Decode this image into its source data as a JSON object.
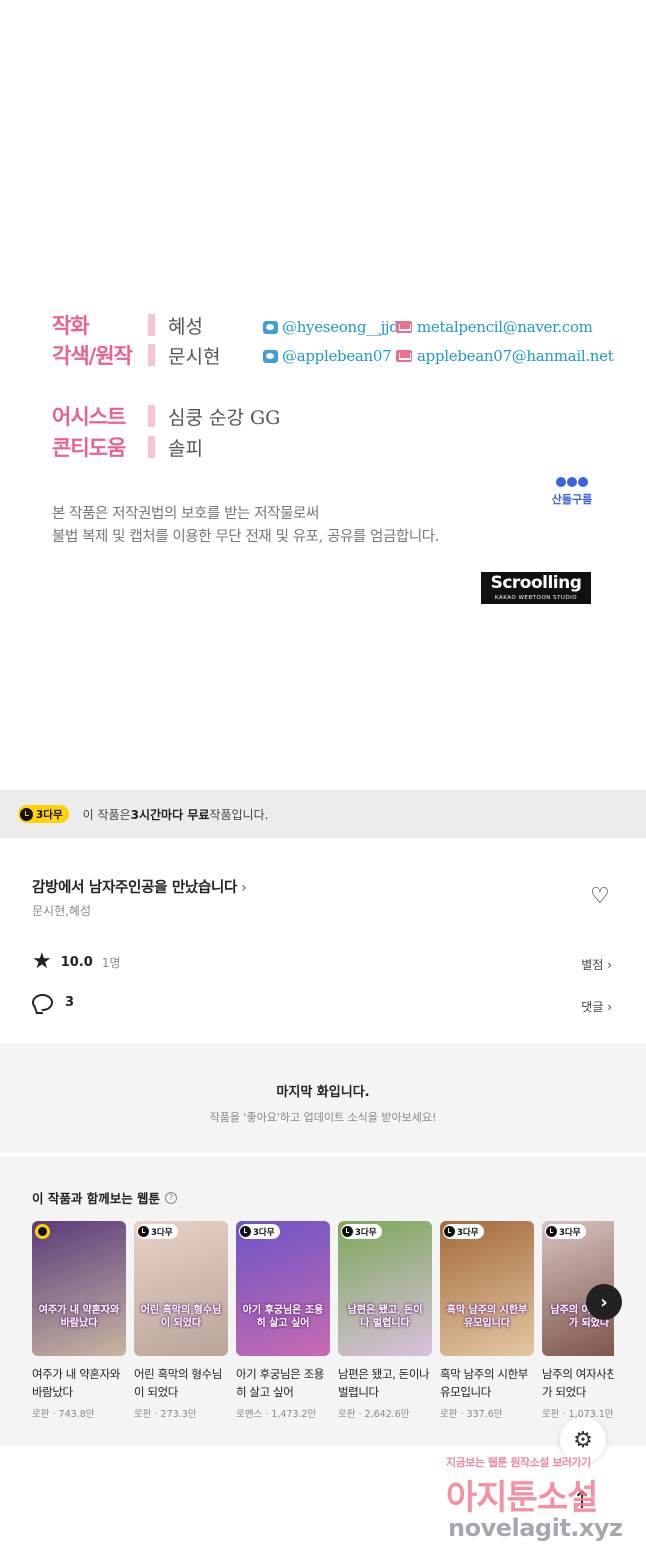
{
  "credits": {
    "rows": [
      {
        "role": "작화",
        "name": "혜성"
      },
      {
        "role": "각색/원작",
        "name": "문시현"
      },
      {
        "role": "어시스트",
        "name": "심쿵 순강 GG"
      },
      {
        "role": "콘티도움",
        "name": "솔피"
      }
    ],
    "social": {
      "twitter_1": "@hyeseong__jjd",
      "mail_1": "metalpencil@naver.com",
      "twitter_2": "@applebean07",
      "mail_2": "applebean07@hanmail.net"
    },
    "studio_label": "산돌구름",
    "notice_line1": "본 작품은 저작권법의 보호를 받는 저작물로써",
    "notice_line2": "불법 복제 및 캡처를 이용한 무단 전재 및 유포, 공유를 엄금합니다.",
    "logo_big": "Scroolling",
    "logo_small": "KAKAO WEBTOON STUDIO"
  },
  "free_banner": {
    "badge": "3다무",
    "text_pre": "이 작품은 ",
    "text_bold": "3시간마다 무료",
    "text_post": " 작품입니다."
  },
  "series": {
    "title": "감방에서 남자주인공을 만났습니다",
    "title_chevron": "›",
    "authors": "문시현,혜성",
    "heart_icon": "♡",
    "rating": "10.0",
    "rating_count": "1명",
    "rating_link": "별점 ›",
    "comments": "3",
    "comment_link": "댓글 ›"
  },
  "last_episode": {
    "title": "마지막 화입니다.",
    "subtitle": "작품을 '좋아요'하고 업데이트 소식을 받아보세요!"
  },
  "recommendations": {
    "title": "이 작품과 함께보는 웹툰",
    "help": "?",
    "items": [
      {
        "name": "여주가 내 약혼자와 바람났다",
        "meta": "로판 · 743.8만",
        "badge": "",
        "cover_text": "여주가 내 약혼자와 바람났다",
        "colors": [
          "#5a3a7a",
          "#c9b6a3"
        ]
      },
      {
        "name": "어린 흑막의 형수님이 되었다",
        "meta": "로판 · 273.3만",
        "badge": "3다무",
        "cover_text": "어린 흑막의 형수님이 되었다",
        "colors": [
          "#e9d2c6",
          "#b9a49a"
        ]
      },
      {
        "name": "아기 후궁님은 조용히 살고 싶어",
        "meta": "로맨스 · 1,473.2만",
        "badge": "3다무",
        "cover_text": "아기 후궁님은 조용히 살고 싶어",
        "colors": [
          "#6c55c7",
          "#c76bb0"
        ]
      },
      {
        "name": "남편은 됐고, 돈이나 벌렵니다",
        "meta": "로판 · 2,642.6만",
        "badge": "3다무",
        "cover_text": "남편은 됐고, 돈이나 벌렵니다",
        "colors": [
          "#7da85a",
          "#d9c1dd"
        ]
      },
      {
        "name": "흑막 남주의 시한부 유모입니다",
        "meta": "로판 · 337.6만",
        "badge": "3다무",
        "cover_text": "흑막 남주의 시한부 유모입니다",
        "colors": [
          "#a56a3d",
          "#e2c8a2"
        ]
      },
      {
        "name": "남주의 여자사친구가 되었다",
        "meta": "로판 · 1,073.1만",
        "badge": "3다무",
        "cover_text": "남주의 여자사친구가 되었다",
        "colors": [
          "#d7c3c0",
          "#7b5147"
        ]
      }
    ],
    "next_icon": "›"
  },
  "floating": {
    "settings_icon": "⚙",
    "top_icon": "↑"
  },
  "watermark": {
    "line1": "지금보는 웹툰 원작소설 보러가기",
    "line2": "아지툰소설",
    "line3": "novelagit.xyz"
  }
}
